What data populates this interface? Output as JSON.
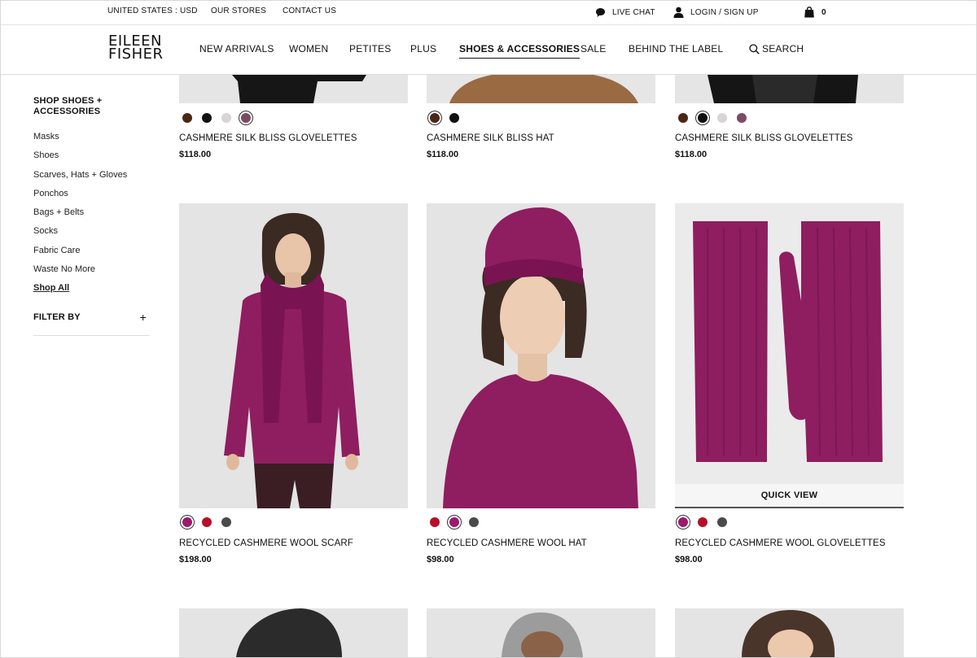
{
  "utility": {
    "locale": "UNITED STATES : USD",
    "stores": "OUR STORES",
    "contact": "CONTACT US",
    "chat": "LIVE CHAT",
    "login": "LOGIN / SIGN UP",
    "cart_count": "0"
  },
  "brand": {
    "line1": "EILEEN",
    "line2": "FISHER"
  },
  "nav": {
    "new_arrivals": "NEW ARRIVALS",
    "women": "WOMEN",
    "petites": "PETITES",
    "plus": "PLUS",
    "shoes": "SHOES & ACCESSORIES",
    "sale": "SALE",
    "behind": "BEHIND THE LABEL",
    "search": "SEARCH"
  },
  "sidebar": {
    "title": "SHOP SHOES + ACCESSORIES",
    "items": [
      "Masks",
      "Shoes",
      "Scarves, Hats + Gloves",
      "Ponchos",
      "Bags + Belts",
      "Socks",
      "Fabric Care",
      "Waste No More",
      "Shop All"
    ],
    "filter": "FILTER BY",
    "filter_icon": "+"
  },
  "products": [
    {
      "name": "CASHMERE SILK BLISS GLOVELETTES",
      "price": "$118.00"
    },
    {
      "name": "CASHMERE SILK BLISS HAT",
      "price": "$118.00"
    },
    {
      "name": "CASHMERE SILK BLISS GLOVELETTES",
      "price": "$118.00"
    },
    {
      "name": "RECYCLED CASHMERE WOOL SCARF",
      "price": "$198.00"
    },
    {
      "name": "RECYCLED CASHMERE WOOL HAT",
      "price": "$98.00"
    },
    {
      "name": "RECYCLED CASHMERE WOOL GLOVELETTES",
      "price": "$98.00"
    }
  ],
  "quick_view": "QUICK VIEW",
  "colors": {
    "brown": "#4a2714",
    "black": "#111111",
    "lightgray": "#d9d4d6",
    "mauve": "#7c4a63",
    "magenta": "#9b1a6c",
    "red": "#b5102a",
    "charcoal": "#4a4a4a"
  },
  "icons": [
    "chat-bubble-icon",
    "user-icon",
    "shopping-bag-icon",
    "search-icon"
  ]
}
